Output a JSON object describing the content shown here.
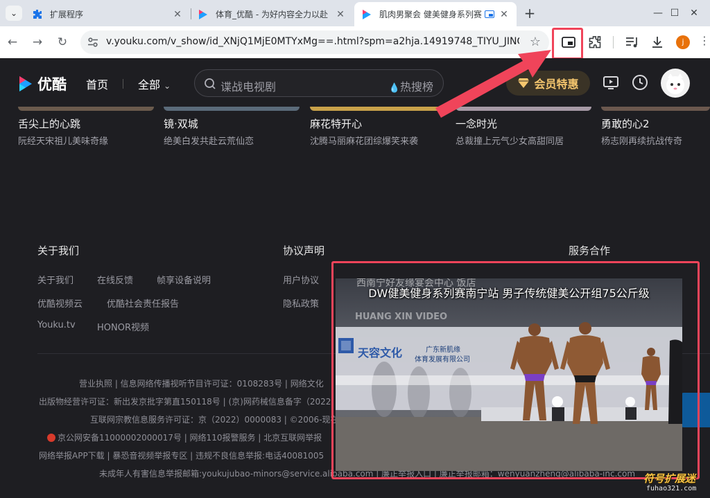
{
  "browser": {
    "tabs": [
      {
        "title": "扩展程序",
        "icon": "puzzle-icon"
      },
      {
        "title": "体育_优酷 - 为好内容全力以赴",
        "icon": "youku-favicon"
      },
      {
        "title": "肌肉男聚会 健美健身系列赛",
        "icon": "youku-favicon"
      }
    ],
    "url": "v.youku.com/v_show/id_XNjQ1MjE0MTYxMg==.html?spm=a2hja.14919748_TIYU_JING...",
    "profile_initial": "j"
  },
  "youku": {
    "logo_text": "优酷",
    "nav": {
      "home": "首页",
      "all": "全部"
    },
    "search_placeholder": "谍战电视剧",
    "hot_search": "热搜榜",
    "vip_label": "会员特惠",
    "cards": [
      {
        "title": "舌尖上的心跳",
        "subtitle": "阮经天宋祖儿美味奇缘"
      },
      {
        "title": "镜·双城",
        "subtitle": "绝美白发共赴云荒仙恋"
      },
      {
        "title": "麻花特开心",
        "subtitle": "沈腾马丽麻花团综爆笑来袭"
      },
      {
        "title": "一念时光",
        "subtitle": "总裁撞上元气少女高甜同居"
      },
      {
        "title": "勇敢的心2",
        "subtitle": "杨志刚再续抗战传奇"
      }
    ],
    "footer": {
      "about": {
        "heading": "关于我们",
        "links": [
          "关于我们",
          "在线反馈",
          "帧享设备说明",
          "优酷视频云",
          "优酷社会责任报告",
          "Youku.tv",
          "HONOR视频"
        ]
      },
      "agreement": {
        "heading": "协议声明",
        "links": [
          "用户协议",
          "隐私政策"
        ]
      },
      "service": {
        "heading": "服务合作"
      },
      "license_lines": [
        "营业执照 | 信息网络传播视听节目许可证：0108283号 | 网络文化",
        "出版物经营许可证：新出发京批字第直150118号 | (京)网药械信息备字（2022",
        "互联网宗教信息服务许可证：京（2022）0000083 | ©2006-现在",
        "京公网安备11000002000017号 | 网络110报警服务 | 北京互联网举报",
        "网络举报APP下载 | 暴恐音视频举报专区 | 违规不良信息举报:电话40081005",
        "未成年人有害信息举报邮箱:youkujubao-minors@service.alibaba.com | 廉正举报入口 | 廉正举报邮箱：wenyuanzheng@alibaba-inc.com"
      ]
    }
  },
  "pip": {
    "caption": "DW健美健身系列赛南宁站 男子传统健美公开组75公斤级",
    "banner_top": "西南宁好友缘宴会中心 饭店",
    "banner_sub": "HUANG XIN VIDEO",
    "sponsor_brand": "天容文化",
    "sponsor_org_line1": "广东新肌缘",
    "sponsor_org_line2": "体育发展有限公司"
  },
  "watermark": {
    "text": "符号扩展迷",
    "url": "fuhao321.com"
  },
  "colors": {
    "highlight": "#f0445a",
    "vip_gold": "#f5c66e",
    "youku_blue": "#1ea0ff"
  }
}
